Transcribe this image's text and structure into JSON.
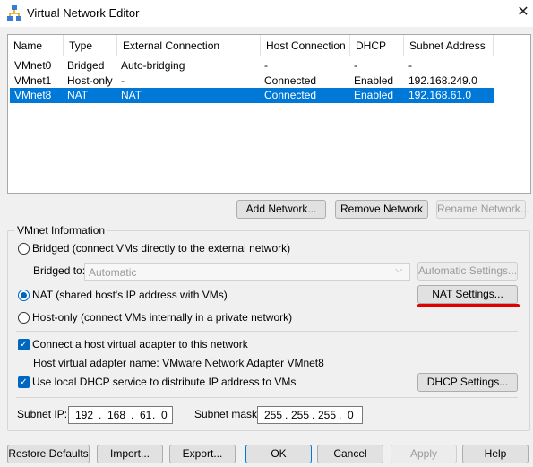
{
  "window": {
    "title": "Virtual Network Editor",
    "close": "✕"
  },
  "table": {
    "headers": [
      "Name",
      "Type",
      "External Connection",
      "Host Connection",
      "DHCP",
      "Subnet Address"
    ],
    "rows": [
      [
        "VMnet0",
        "Bridged",
        "Auto-bridging",
        "-",
        "-",
        "-"
      ],
      [
        "VMnet1",
        "Host-only",
        "-",
        "Connected",
        "Enabled",
        "192.168.249.0"
      ],
      [
        "VMnet8",
        "NAT",
        "NAT",
        "Connected",
        "Enabled",
        "192.168.61.0"
      ]
    ],
    "selected_row": 2
  },
  "actions": {
    "add": "Add Network...",
    "remove": "Remove Network",
    "rename": "Rename Network..."
  },
  "info": {
    "title": "VMnet Information",
    "bridged": "Bridged (connect VMs directly to the external network)",
    "bridged_to": "Bridged to:",
    "bridged_value": "Automatic",
    "auto_settings": "Automatic Settings...",
    "nat": "NAT (shared host's IP address with VMs)",
    "nat_settings": "NAT Settings...",
    "hostonly": "Host-only (connect VMs internally in a private network)",
    "connect_adapter": "Connect a host virtual adapter to this network",
    "adapter_name": "Host virtual adapter name: VMware Network Adapter VMnet8",
    "use_dhcp": "Use local DHCP service to distribute IP address to VMs",
    "dhcp_settings": "DHCP Settings...",
    "subnet_ip_label": "Subnet IP:",
    "subnet_ip": [
      "192",
      "168",
      "61",
      "0"
    ],
    "subnet_mask_label": "Subnet mask:",
    "subnet_mask": [
      "255",
      "255",
      "255",
      "0"
    ],
    "ip_dots": [
      "."
    ]
  },
  "footer": {
    "restore": "Restore Defaults",
    "import": "Import...",
    "export": "Export...",
    "ok": "OK",
    "cancel": "Cancel",
    "apply": "Apply",
    "help": "Help"
  },
  "colors": {
    "selection": "#0078d7",
    "annotation": "#e00000"
  },
  "icons": {
    "app": "network-icon",
    "close": "close-icon",
    "dropdown": "chevron-down-icon"
  }
}
